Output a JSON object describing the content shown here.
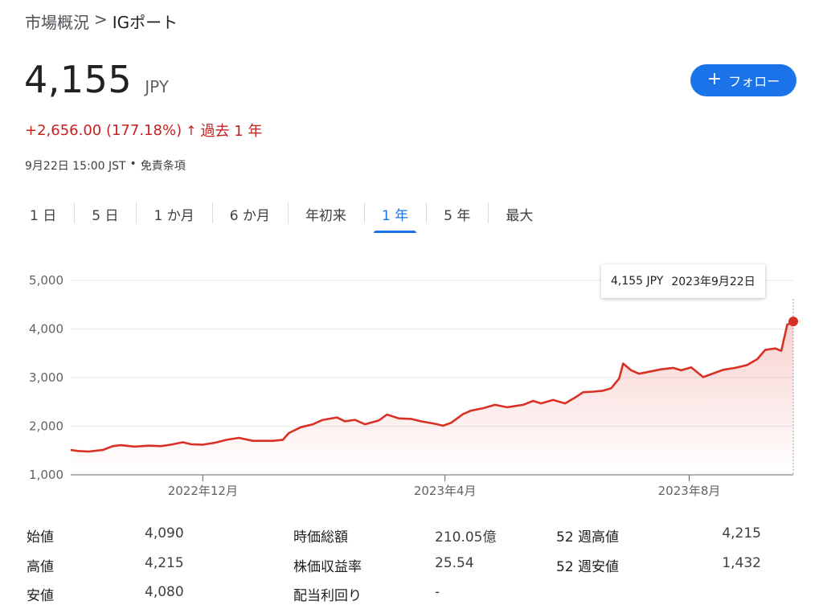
{
  "breadcrumb": {
    "parent": "市場概況",
    "separator": ">",
    "current": "IGポート"
  },
  "quote": {
    "price": "4,155",
    "currency": "JPY",
    "change": "+2,656.00 (177.18%)",
    "change_arrow": "↑",
    "period": "過去 1 年",
    "timestamp": "9月22日 15:00 JST",
    "dot": "•",
    "disclaimer": "免責条項"
  },
  "follow": {
    "icon": "plus-icon",
    "label": "フォロー",
    "color": "#1a73e8"
  },
  "tabs": [
    "1 日",
    "5 日",
    "1 か月",
    "6 か月",
    "年初来",
    "1 年",
    "5 年",
    "最大"
  ],
  "active_tab": "1 年",
  "tooltip": {
    "value": "4,155 JPY",
    "date": "2023年9月22日"
  },
  "colors": {
    "line": "#d93025",
    "negative": "#c5221f",
    "accent": "#1a73e8"
  },
  "chart_data": {
    "type": "area",
    "title": "",
    "xlabel": "",
    "ylabel": "",
    "x_range": [
      "2022-09-26",
      "2023-09-22"
    ],
    "ylim": [
      1000,
      5000
    ],
    "yticks": [
      1000,
      2000,
      3000,
      4000,
      5000
    ],
    "ytick_labels": [
      "1,000",
      "2,000",
      "3,000",
      "4,000",
      "5,000"
    ],
    "xtick_labels": [
      {
        "date": "2022-12-01",
        "label": "2022年12月"
      },
      {
        "date": "2023-04-01",
        "label": "2023年4月"
      },
      {
        "date": "2023-08-01",
        "label": "2023年8月"
      }
    ],
    "grid": true,
    "series": [
      {
        "points": [
          [
            "2022-09-26",
            1510
          ],
          [
            "2022-09-30",
            1490
          ],
          [
            "2022-10-05",
            1480
          ],
          [
            "2022-10-12",
            1510
          ],
          [
            "2022-10-17",
            1590
          ],
          [
            "2022-10-21",
            1610
          ],
          [
            "2022-10-28",
            1580
          ],
          [
            "2022-11-04",
            1600
          ],
          [
            "2022-11-10",
            1590
          ],
          [
            "2022-11-15",
            1620
          ],
          [
            "2022-11-21",
            1670
          ],
          [
            "2022-11-25",
            1630
          ],
          [
            "2022-12-01",
            1620
          ],
          [
            "2022-12-07",
            1660
          ],
          [
            "2022-12-13",
            1720
          ],
          [
            "2022-12-19",
            1760
          ],
          [
            "2022-12-26",
            1700
          ],
          [
            "2023-01-05",
            1700
          ],
          [
            "2023-01-10",
            1720
          ],
          [
            "2023-01-13",
            1860
          ],
          [
            "2023-01-19",
            1980
          ],
          [
            "2023-01-25",
            2040
          ],
          [
            "2023-01-30",
            2130
          ],
          [
            "2023-02-06",
            2180
          ],
          [
            "2023-02-10",
            2100
          ],
          [
            "2023-02-15",
            2130
          ],
          [
            "2023-02-20",
            2040
          ],
          [
            "2023-02-27",
            2120
          ],
          [
            "2023-03-03",
            2240
          ],
          [
            "2023-03-09",
            2160
          ],
          [
            "2023-03-15",
            2150
          ],
          [
            "2023-03-20",
            2100
          ],
          [
            "2023-03-27",
            2050
          ],
          [
            "2023-03-31",
            2010
          ],
          [
            "2023-04-04",
            2070
          ],
          [
            "2023-04-10",
            2250
          ],
          [
            "2023-04-14",
            2320
          ],
          [
            "2023-04-20",
            2370
          ],
          [
            "2023-04-26",
            2440
          ],
          [
            "2023-05-02",
            2390
          ],
          [
            "2023-05-10",
            2440
          ],
          [
            "2023-05-15",
            2520
          ],
          [
            "2023-05-19",
            2470
          ],
          [
            "2023-05-25",
            2540
          ],
          [
            "2023-05-31",
            2470
          ],
          [
            "2023-06-05",
            2590
          ],
          [
            "2023-06-09",
            2700
          ],
          [
            "2023-06-14",
            2710
          ],
          [
            "2023-06-19",
            2730
          ],
          [
            "2023-06-23",
            2780
          ],
          [
            "2023-06-27",
            2980
          ],
          [
            "2023-06-29",
            3290
          ],
          [
            "2023-07-03",
            3150
          ],
          [
            "2023-07-07",
            3080
          ],
          [
            "2023-07-12",
            3120
          ],
          [
            "2023-07-18",
            3170
          ],
          [
            "2023-07-24",
            3200
          ],
          [
            "2023-07-28",
            3150
          ],
          [
            "2023-08-02",
            3210
          ],
          [
            "2023-08-08",
            3010
          ],
          [
            "2023-08-14",
            3100
          ],
          [
            "2023-08-18",
            3160
          ],
          [
            "2023-08-24",
            3200
          ],
          [
            "2023-08-30",
            3260
          ],
          [
            "2023-09-04",
            3380
          ],
          [
            "2023-09-08",
            3570
          ],
          [
            "2023-09-13",
            3600
          ],
          [
            "2023-09-16",
            3550
          ],
          [
            "2023-09-19",
            4090
          ],
          [
            "2023-09-22",
            4155
          ]
        ]
      }
    ]
  },
  "stats": {
    "open_label": "始値",
    "open_value": "4,090",
    "high_label": "高値",
    "high_value": "4,215",
    "low_label": "安値",
    "low_value": "4,080",
    "mktcap_label": "時価総額",
    "mktcap_value": "210.05億",
    "pe_label": "株価収益率",
    "pe_value": "25.54",
    "div_label": "配当利回り",
    "div_value": "-",
    "wk52_high_label": "52 週高値",
    "wk52_high_value": "4,215",
    "wk52_low_label": "52 週安値",
    "wk52_low_value": "1,432"
  }
}
